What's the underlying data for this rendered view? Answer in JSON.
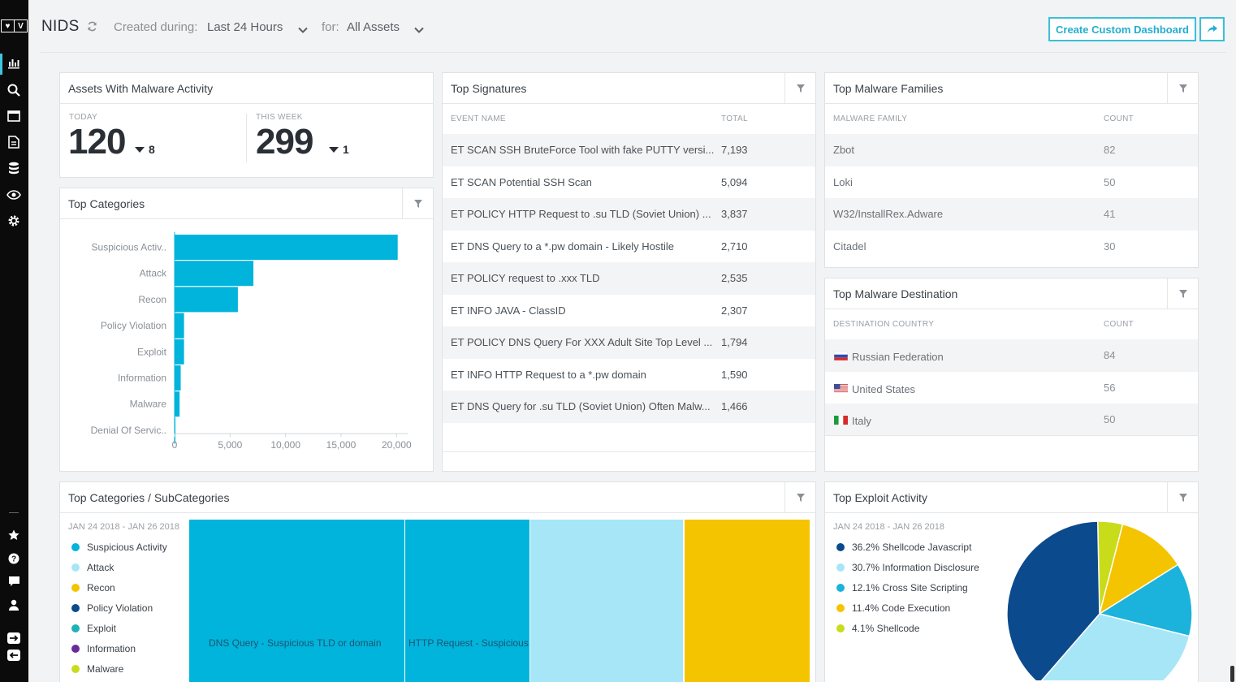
{
  "logo": {
    "left": "♥",
    "right": "V"
  },
  "header": {
    "title": "NIDS",
    "created_label": "Created during:",
    "created_value": "Last 24 Hours",
    "for_label": "for:",
    "for_value": "All Assets",
    "create_button": "Create Custom Dashboard"
  },
  "sidebar": {
    "top_icons": [
      "dashboard-icon",
      "search-icon",
      "calendar-icon",
      "report-icon",
      "database-icon",
      "eye-icon",
      "gear-icon"
    ],
    "bottom_icons": [
      "star-icon",
      "help-icon",
      "chat-icon",
      "user-icon",
      "expand-icon",
      "collapse-icon"
    ]
  },
  "assets_malware": {
    "title": "Assets With Malware Activity",
    "today_label": "TODAY",
    "today_value": "120",
    "today_delta": "8",
    "week_label": "THIS WEEK",
    "week_value": "299",
    "week_delta": "1"
  },
  "top_categories": {
    "title": "Top Categories",
    "chart_data": {
      "type": "bar",
      "orientation": "horizontal",
      "categories": [
        "Suspicious Activ..",
        "Attack",
        "Recon",
        "Policy Violation",
        "Exploit",
        "Information",
        "Malware",
        "Denial Of Servic.."
      ],
      "values": [
        20100,
        7100,
        5700,
        850,
        850,
        550,
        450,
        30
      ],
      "xticks": [
        "0",
        "5,000",
        "10,000",
        "15,000",
        "20,000"
      ],
      "xlim": [
        0,
        21000
      ],
      "color": "#00b4dc"
    }
  },
  "top_signatures": {
    "title": "Top Signatures",
    "col_name": "EVENT NAME",
    "col_total": "TOTAL",
    "rows": [
      {
        "name": "ET SCAN SSH BruteForce Tool with fake PUTTY versi...",
        "total": "7,193"
      },
      {
        "name": "ET SCAN Potential SSH Scan",
        "total": "5,094"
      },
      {
        "name": "ET POLICY HTTP Request to .su TLD (Soviet Union) ...",
        "total": "3,837"
      },
      {
        "name": "ET DNS Query to a *.pw domain - Likely Hostile",
        "total": "2,710"
      },
      {
        "name": "ET POLICY request to .xxx TLD",
        "total": "2,535"
      },
      {
        "name": "ET INFO JAVA - ClassID",
        "total": "2,307"
      },
      {
        "name": "ET POLICY DNS Query For XXX Adult Site Top Level ...",
        "total": "1,794"
      },
      {
        "name": "ET INFO HTTP Request to a *.pw domain",
        "total": "1,590"
      },
      {
        "name": "ET DNS Query for .su TLD (Soviet Union) Often Malw...",
        "total": "1,466"
      }
    ]
  },
  "top_malware_families": {
    "title": "Top Malware Families",
    "col_name": "MALWARE FAMILY",
    "col_count": "COUNT",
    "rows": [
      {
        "name": "Zbot",
        "count": "82"
      },
      {
        "name": "Loki",
        "count": "50"
      },
      {
        "name": "W32/InstallRex.Adware",
        "count": "41"
      },
      {
        "name": "Citadel",
        "count": "30"
      }
    ]
  },
  "top_malware_destination": {
    "title": "Top Malware Destination",
    "col_name": "DESTINATION COUNTRY",
    "col_count": "COUNT",
    "rows": [
      {
        "name": "Russian Federation",
        "count": "84",
        "flag": "ru"
      },
      {
        "name": "United States",
        "count": "56",
        "flag": "us"
      },
      {
        "name": "Italy",
        "count": "50",
        "flag": "it"
      }
    ]
  },
  "categories_subcategories": {
    "title": "Top Categories / SubCategories",
    "date_range": "JAN 24 2018 - JAN 26 2018",
    "legend": [
      {
        "label": "Suspicious Activity",
        "color": "#00b4dc"
      },
      {
        "label": "Attack",
        "color": "#a6e6f7"
      },
      {
        "label": "Recon",
        "color": "#f5c400"
      },
      {
        "label": "Policy Violation",
        "color": "#0b4a8c"
      },
      {
        "label": "Exploit",
        "color": "#1bb3b8"
      },
      {
        "label": "Information",
        "color": "#6a2a9a"
      },
      {
        "label": "Malware",
        "color": "#c8dc1a"
      }
    ],
    "treemap": [
      {
        "label": "DNS Query - Suspicious TLD or domain",
        "color": "#00b4dc"
      },
      {
        "label": "HTTP Request - Suspicious",
        "color": "#00b4dc"
      },
      {
        "label": "",
        "color": "#a6e6f7"
      },
      {
        "label": "",
        "color": "#f5c400"
      }
    ]
  },
  "top_exploit_activity": {
    "title": "Top Exploit Activity",
    "date_range": "JAN 24 2018 - JAN 26 2018",
    "legend": [
      {
        "label": "36.2% Shellcode Javascript",
        "color": "#0b4a8c"
      },
      {
        "label": "30.7% Information Disclosure",
        "color": "#a6e6f7"
      },
      {
        "label": "12.1% Cross Site Scripting",
        "color": "#1bb3dc"
      },
      {
        "label": "11.4% Code Execution",
        "color": "#f5c400"
      },
      {
        "label": "4.1% Shellcode",
        "color": "#c8dc1a"
      }
    ],
    "chart_data": {
      "type": "pie",
      "slices": [
        {
          "label": "Shellcode Javascript",
          "value": 36.2,
          "color": "#0b4a8c"
        },
        {
          "label": "Information Disclosure",
          "value": 30.7,
          "color": "#a6e6f7"
        },
        {
          "label": "Cross Site Scripting",
          "value": 12.1,
          "color": "#1bb3dc"
        },
        {
          "label": "Code Execution",
          "value": 11.4,
          "color": "#f5c400"
        },
        {
          "label": "Shellcode",
          "value": 4.1,
          "color": "#c8dc1a"
        }
      ]
    }
  }
}
